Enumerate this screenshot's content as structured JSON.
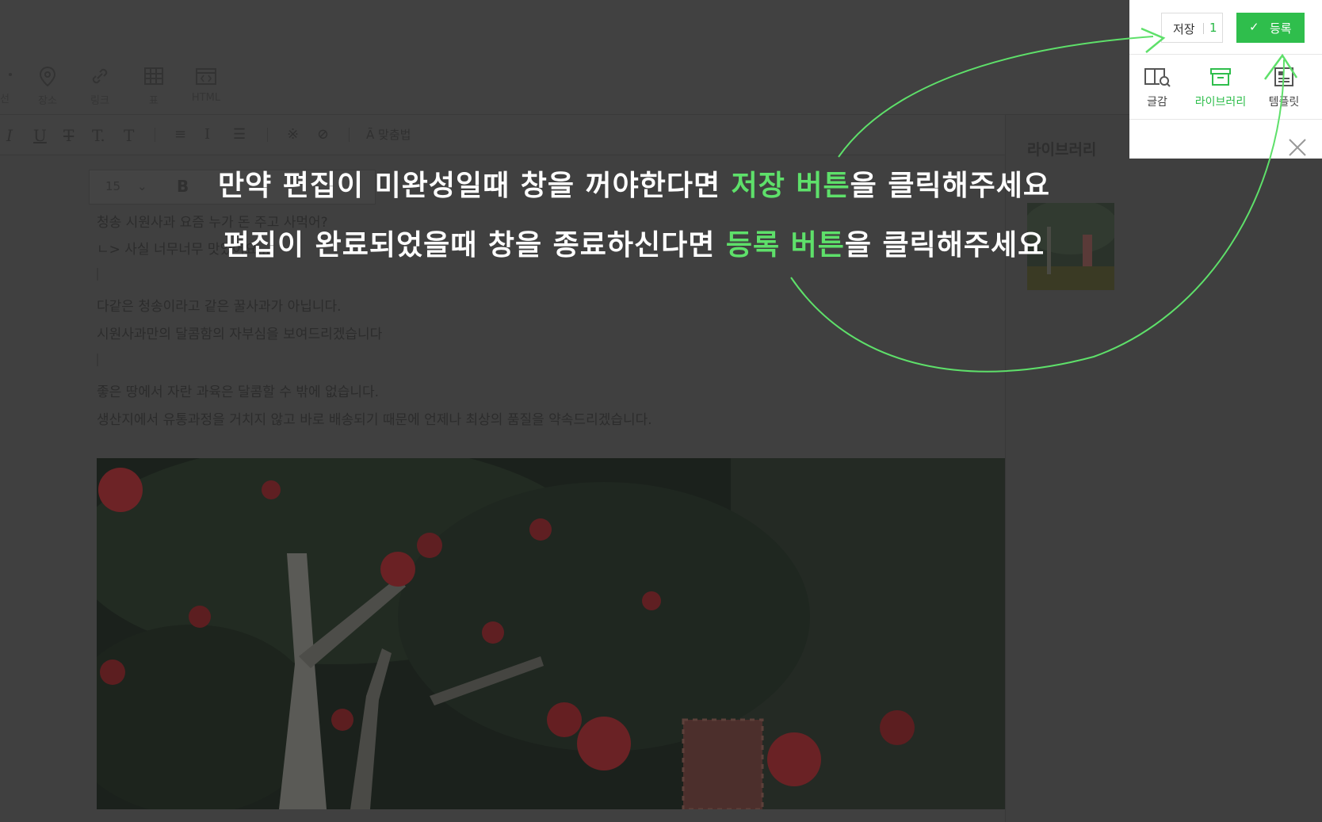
{
  "toolbar": {
    "insert_items": [
      {
        "label": "선",
        "icon": "line-icon"
      },
      {
        "label": "장소",
        "icon": "map-pin-icon"
      },
      {
        "label": "링크",
        "icon": "link-icon"
      },
      {
        "label": "표",
        "icon": "table-icon"
      },
      {
        "label": "HTML",
        "icon": "html-icon"
      }
    ],
    "spellcheck_label": "맞춤법",
    "font_size": "15",
    "bold_label": "B"
  },
  "content": {
    "lines": [
      "청송 시원사과 요즘 누가 돈 주고 사먹어?",
      "ㄴ> 사실 너무너무 맛있어요...",
      "다같은 청송이라고 같은 꿀사과가 아닙니다.",
      "시원사과만의 달콤함의 자부심을 보여드리겠습니다",
      "좋은 땅에서 자란 과육은 달콤할 수 밖에 없습니다.",
      "생산지에서 유통과정을 거치지 않고 바로 배송되기 때문에 언제나 최상의 품질을 약속드리겠습니다."
    ]
  },
  "library": {
    "title": "라이브러리"
  },
  "panel": {
    "save_label": "저장",
    "save_count": "1",
    "register_label": "등록",
    "tabs": [
      {
        "label": "글감",
        "icon": "book-search-icon"
      },
      {
        "label": "라이브러리",
        "icon": "archive-box-icon"
      },
      {
        "label": "템플릿",
        "icon": "template-icon"
      }
    ],
    "active_tab": "라이브러리",
    "accent_color": "#2fbe4c"
  },
  "overlay": {
    "line1_prefix": "만약 편집이 미완성일때 창을 꺼야한다면 ",
    "line1_highlight": "저장 버튼",
    "line1_suffix": "을 클릭해주세요",
    "line2_prefix": "편집이 완료되었을때 창을 종료하신다면 ",
    "line2_highlight": "등록 버튼",
    "line2_suffix": "을 클릭해주세요",
    "highlight_color": "#5ee06a"
  }
}
